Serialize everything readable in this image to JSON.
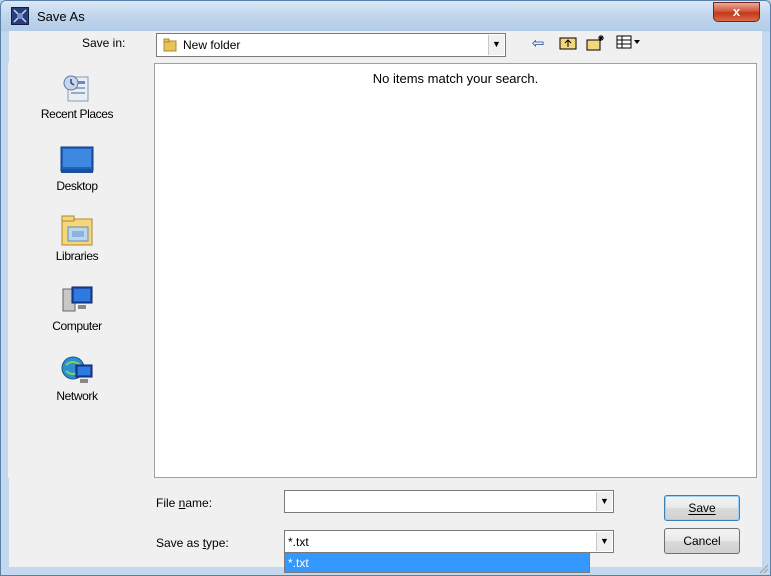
{
  "window": {
    "title": "Save As",
    "close_label": "x"
  },
  "toolbar": {
    "save_in_label": "Save in:",
    "current_folder": "New folder",
    "buttons": [
      {
        "name": "back-arrow-icon",
        "glyph": "⇦"
      },
      {
        "name": "up-folder-icon",
        "glyph": "⮥"
      },
      {
        "name": "new-folder-icon",
        "glyph": "✱"
      },
      {
        "name": "view-menu-icon",
        "glyph": "▦▾"
      }
    ]
  },
  "places": [
    {
      "label": "Recent Places",
      "icon": "recent-places-icon"
    },
    {
      "label": "Desktop",
      "icon": "desktop-icon"
    },
    {
      "label": "Libraries",
      "icon": "libraries-icon"
    },
    {
      "label": "Computer",
      "icon": "computer-icon"
    },
    {
      "label": "Network",
      "icon": "network-icon"
    }
  ],
  "file_list": {
    "empty_message": "No items match your search."
  },
  "form": {
    "file_name_label": "File name:",
    "file_name_value": "",
    "save_as_type_label": "Save as type:",
    "save_as_type_value": "*.txt",
    "type_options": [
      "*.txt"
    ]
  },
  "buttons": {
    "save_label": "Save",
    "cancel_label": "Cancel"
  },
  "colors": {
    "selection": "#3399ff",
    "close": "#c4391a"
  }
}
